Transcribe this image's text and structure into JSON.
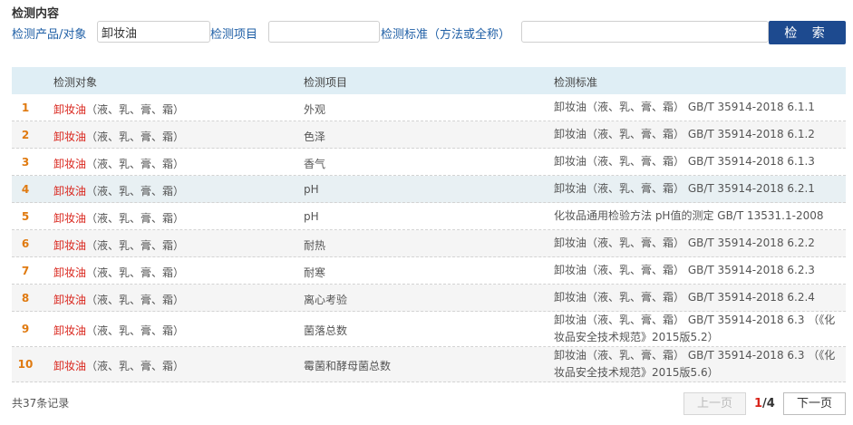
{
  "section_title": "检测内容",
  "search": {
    "product_label": "检测产品/对象",
    "product_value": "卸妆油",
    "item_label": "检测项目",
    "item_value": "",
    "standard_label": "检测标准（方法或全称）",
    "standard_value": "",
    "button_label": "检 索"
  },
  "table": {
    "headers": [
      "检测对象",
      "检测项目",
      "检测标准"
    ],
    "rows": [
      {
        "num": "1",
        "product": "卸妆油",
        "types": "（液、乳、膏、霜）",
        "item": "外观",
        "standard": "卸妆油（液、乳、膏、霜） GB/T 35914-2018 6.1.1"
      },
      {
        "num": "2",
        "product": "卸妆油",
        "types": "（液、乳、膏、霜）",
        "item": "色泽",
        "standard": "卸妆油（液、乳、膏、霜） GB/T 35914-2018 6.1.2"
      },
      {
        "num": "3",
        "product": "卸妆油",
        "types": "（液、乳、膏、霜）",
        "item": "香气",
        "standard": "卸妆油（液、乳、膏、霜） GB/T 35914-2018 6.1.3"
      },
      {
        "num": "4",
        "product": "卸妆油",
        "types": "（液、乳、膏、霜）",
        "item": "pH",
        "standard": "卸妆油（液、乳、膏、霜） GB/T 35914-2018 6.2.1"
      },
      {
        "num": "5",
        "product": "卸妆油",
        "types": "（液、乳、膏、霜）",
        "item": "pH",
        "standard": "化妆品通用检验方法 pH值的测定 GB/T 13531.1-2008"
      },
      {
        "num": "6",
        "product": "卸妆油",
        "types": "（液、乳、膏、霜）",
        "item": "耐热",
        "standard": "卸妆油（液、乳、膏、霜） GB/T 35914-2018 6.2.2"
      },
      {
        "num": "7",
        "product": "卸妆油",
        "types": "（液、乳、膏、霜）",
        "item": "耐寒",
        "standard": "卸妆油（液、乳、膏、霜） GB/T 35914-2018 6.2.3"
      },
      {
        "num": "8",
        "product": "卸妆油",
        "types": "（液、乳、膏、霜）",
        "item": "离心考验",
        "standard": "卸妆油（液、乳、膏、霜） GB/T 35914-2018 6.2.4"
      },
      {
        "num": "9",
        "product": "卸妆油",
        "types": "（液、乳、膏、霜）",
        "item": "菌落总数",
        "standard": "卸妆油（液、乳、膏、霜） GB/T 35914-2018 6.3 （《化妆品安全技术规范》2015版5.2）"
      },
      {
        "num": "10",
        "product": "卸妆油",
        "types": "（液、乳、膏、霜）",
        "item": "霉菌和酵母菌总数",
        "standard": "卸妆油（液、乳、膏、霜） GB/T 35914-2018 6.3 （《化妆品安全技术规范》2015版5.6）"
      }
    ]
  },
  "footer": {
    "total": "共37条记录",
    "prev_label": "上一页",
    "current_page": "1",
    "total_pages": "/4",
    "next_label": "下一页"
  },
  "colors": {
    "accent": "#1d4a8f",
    "label_blue": "#1f5fa6",
    "product_red": "#d9241b",
    "number_orange": "#e07a10",
    "header_bg": "#dfeef5"
  }
}
